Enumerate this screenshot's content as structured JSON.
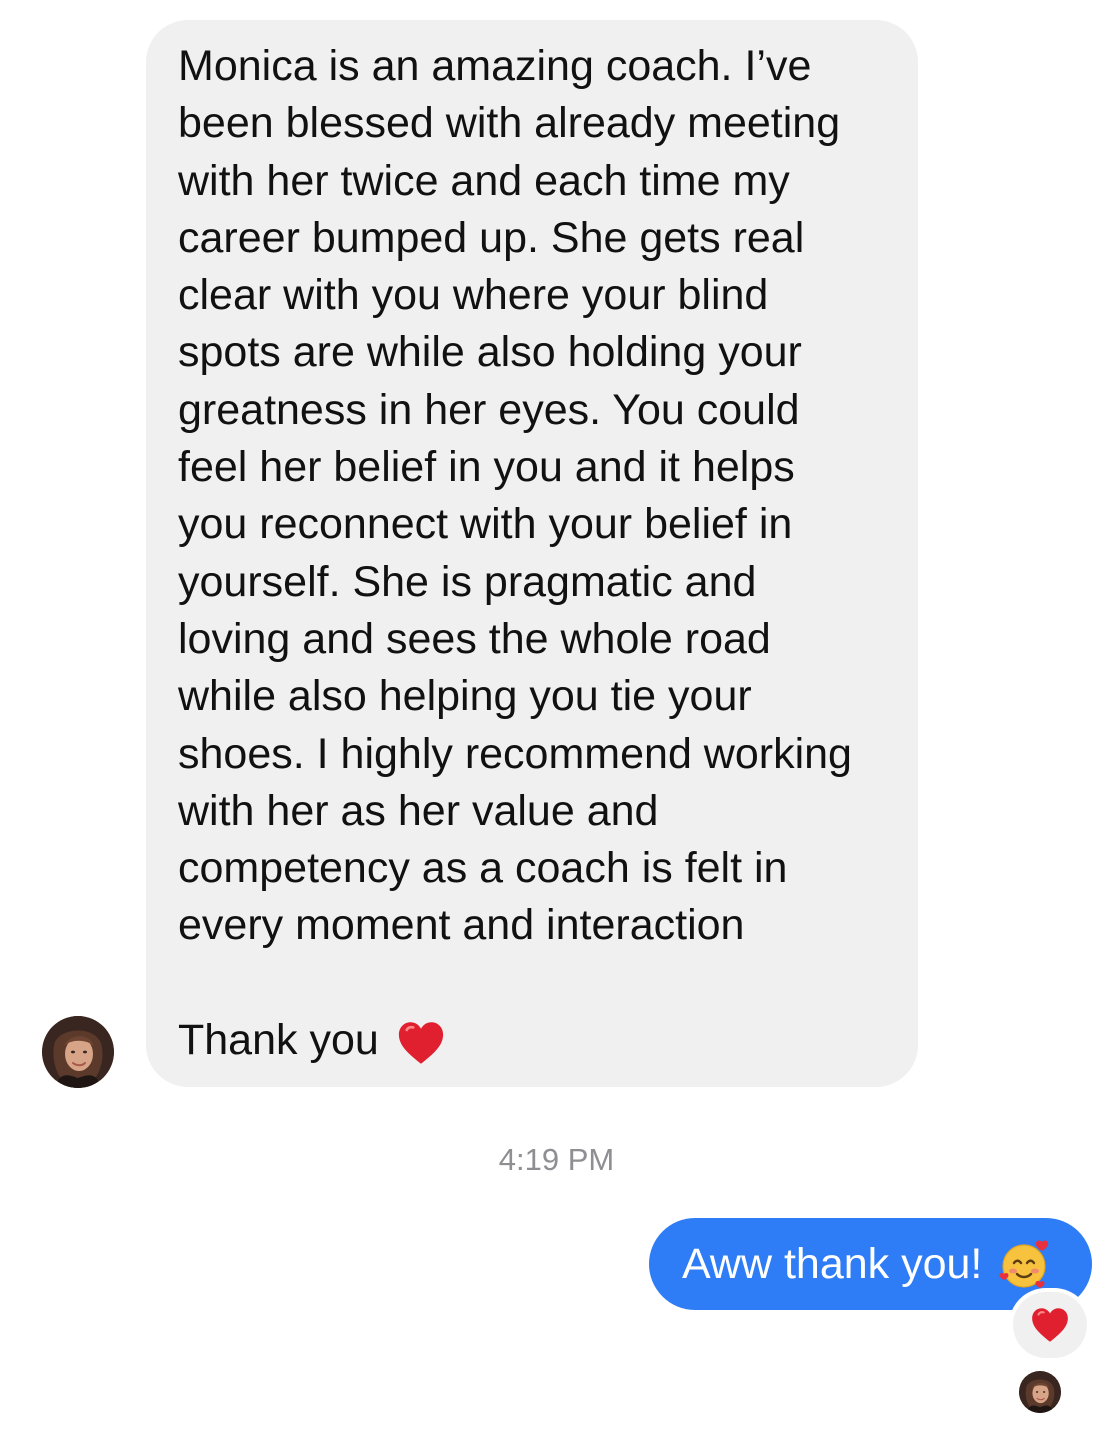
{
  "incoming_message": {
    "text": "Monica is an amazing coach. I’ve\nbeen blessed with already meeting\nwith her twice and each time my\ncareer bumped up. She gets real\nclear with you where your blind\nspots are while also holding your\ngreatness in her eyes. You could\nfeel her belief in you and it helps\nyou reconnect with your belief in\nyourself. She is pragmatic and\nloving and sees the whole road\nwhile also helping you tie your\nshoes. I highly recommend working\nwith her as her value and\ncompetency as a coach is felt in\nevery moment and interaction",
    "closing": "Thank you",
    "closing_emoji": "red-heart"
  },
  "timestamp": "4:19 PM",
  "outgoing_message": {
    "text": "Aww thank you!",
    "emoji": "smiling-face-with-hearts",
    "reaction": "red-heart"
  },
  "colors": {
    "incoming_bubble": "#f0f0f0",
    "outgoing_bubble": "#2e7cf6",
    "timestamp": "#8e8e93",
    "heart": "#e0202e"
  }
}
